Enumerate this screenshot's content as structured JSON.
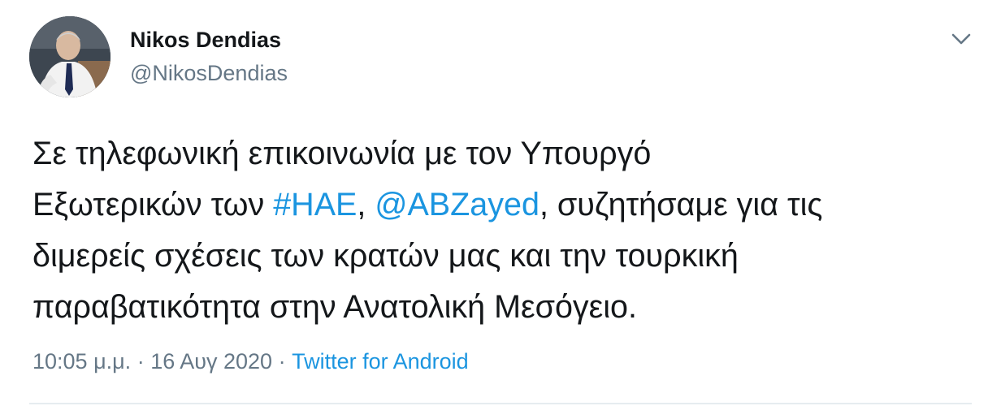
{
  "author": {
    "name": "Nikos Dendias",
    "handle": "@NikosDendias"
  },
  "tweet": {
    "line1": "Σε τηλεφωνική επικοινωνία με τον Υπουργό",
    "line2_prefix": "Εξωτερικών των ",
    "hashtag": "#ΗΑΕ",
    "sep": ", ",
    "mention": "@ABZayed",
    "line2_suffix": ", συζητήσαμε για τις",
    "line3": "διμερείς σχέσεις των κρατών μας και την τουρκική",
    "line4": "παραβατικότητα στην Ανατολική Μεσόγειο."
  },
  "meta": {
    "time": "10:05 μ.μ.",
    "dot1": " · ",
    "date": "16 Αυγ 2020",
    "dot2": " · ",
    "source": "Twitter for Android"
  },
  "icons": {
    "caret": "chevron-down-icon",
    "avatar": "profile-photo"
  },
  "colors": {
    "link": "#1b95e0",
    "secondary": "#657786",
    "text": "#14171a"
  }
}
